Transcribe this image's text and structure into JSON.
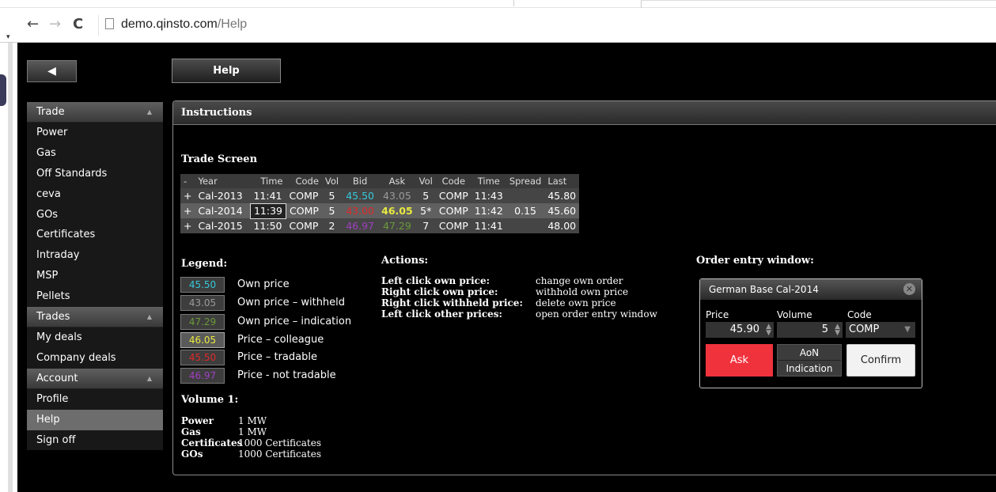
{
  "browser": {
    "url_host": "demo.qinsto.com",
    "url_path": "/Help"
  },
  "header": {
    "back_label": "◀",
    "help_label": "Help"
  },
  "sidebar": {
    "trade_header": "Trade",
    "trade_items": [
      "Power",
      "Gas",
      "Off Standards",
      "ceva",
      "GOs",
      "Certificates",
      "Intraday",
      "MSP",
      "Pellets"
    ],
    "trades_header": "Trades",
    "trades_items": [
      "My deals",
      "Company deals"
    ],
    "account_header": "Account",
    "account_items": [
      "Profile",
      "Help",
      "Sign off"
    ],
    "active_item": "Help"
  },
  "panel": {
    "title": "Instructions",
    "trade_screen_title": "Trade Screen",
    "table": {
      "headers": [
        "-",
        "Year",
        "Time",
        "Code",
        "Vol",
        "Bid",
        "Ask",
        "Vol",
        "Code",
        "Time",
        "Spread",
        "Last"
      ],
      "rows": [
        [
          "+",
          "Cal-2013",
          "11:41",
          "COMP",
          "5",
          "45.50",
          "43.05",
          "5",
          "COMP",
          "11:43",
          "",
          "45.80"
        ],
        [
          "+",
          "Cal-2014",
          "11:39",
          "COMP",
          "5",
          "43.00",
          "46.05",
          "5*",
          "COMP",
          "11:42",
          "0.15",
          "45.60"
        ],
        [
          "+",
          "Cal-2015",
          "11:50",
          "COMP",
          "2",
          "46.97",
          "47.29",
          "7",
          "COMP",
          "11:41",
          "",
          "48.00"
        ]
      ]
    },
    "legend_title": "Legend:",
    "legend": [
      {
        "value": "45.50",
        "label": "Own price",
        "color": "#35c8d8"
      },
      {
        "value": "43.05",
        "label": "Own price – withheld",
        "color": "#9a9a9a"
      },
      {
        "value": "47.29",
        "label": "Own price – indication",
        "color": "#6a9a3a"
      },
      {
        "value": "46.05",
        "label": "Price – colleague",
        "color": "#e8e840"
      },
      {
        "value": "45.50",
        "label": "Price – tradable",
        "color": "#e02a2a"
      },
      {
        "value": "46.97",
        "label": "Price - not tradable",
        "color": "#a040c0"
      }
    ],
    "volume_title": "Volume 1:",
    "volume": [
      {
        "k": "Power",
        "v": "1 MW"
      },
      {
        "k": "Gas",
        "v": "1 MW"
      },
      {
        "k": "Certificates",
        "v": "1000 Certificates"
      },
      {
        "k": "GOs",
        "v": "1000 Certificates"
      }
    ],
    "actions_title": "Actions:",
    "actions": [
      {
        "k": "Left click own price:",
        "v": "change own order"
      },
      {
        "k": "Right click own price:",
        "v": "withhold own price"
      },
      {
        "k": "Right click withheld price:",
        "v": "delete own price"
      },
      {
        "k": "Left click other prices:",
        "v": "open order entry window"
      }
    ],
    "order_title": "Order entry window:",
    "order": {
      "window_title": "German Base Cal-2014",
      "close": "✕",
      "price_label": "Price",
      "volume_label": "Volume",
      "code_label": "Code",
      "price": "45.90",
      "volume": "5",
      "code": "COMP",
      "ask": "Ask",
      "aon": "AoN",
      "indication": "Indication",
      "confirm": "Confirm"
    }
  },
  "colors": {
    "own": "#35c8d8",
    "withheld": "#9a9a9a",
    "indication": "#6a9a3a",
    "colleague": "#e8e840",
    "tradable": "#e02a2a",
    "not_tradable": "#a040c0",
    "ask_button": "#f0323d"
  }
}
